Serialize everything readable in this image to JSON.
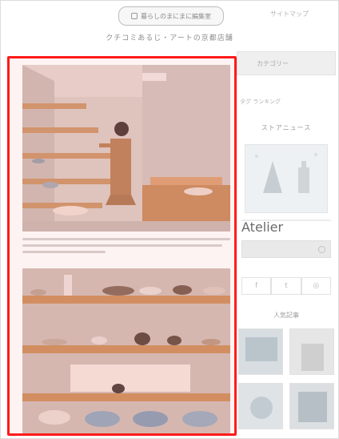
{
  "header": {
    "badge_title": "暮らしのまにまに編集室",
    "top_link": "サイトマップ",
    "subtitle": "クチコミあるじ・アートの京都店舗"
  },
  "sidebar": {
    "tab_label": "カテゴリー",
    "sub_label": "タグ ランキング",
    "heading": "ストアニュース",
    "banner_text": "Atelier",
    "social": [
      "f",
      "t",
      "◎"
    ],
    "popular_heading": "人気記事"
  },
  "colors": {
    "highlight": "#ff1a1a"
  }
}
